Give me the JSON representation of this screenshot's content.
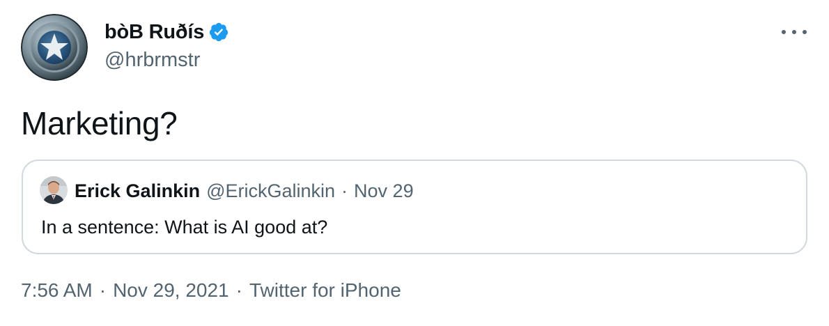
{
  "author": {
    "display_name": "bòB Ruðís",
    "handle": "@hrbrmstr",
    "avatar_icon": "captain-america-shield-icon",
    "verified_icon": "verified-badge-icon"
  },
  "more_icon": "more-options-icon",
  "tweet": {
    "text": "Marketing?"
  },
  "quoted_tweet": {
    "author_name": "Erick Galinkin",
    "author_handle": "@ErickGalinkin",
    "separator": "·",
    "date": "Nov 29",
    "text": "In a sentence: What is AI good at?"
  },
  "meta": {
    "time": "7:56 AM",
    "date": "Nov 29, 2021",
    "separator": "·",
    "source": "Twitter for iPhone"
  },
  "colors": {
    "text_primary": "#0f1419",
    "text_secondary": "#536471",
    "verified_blue": "#1d9bf0",
    "border": "#cfd9de"
  }
}
